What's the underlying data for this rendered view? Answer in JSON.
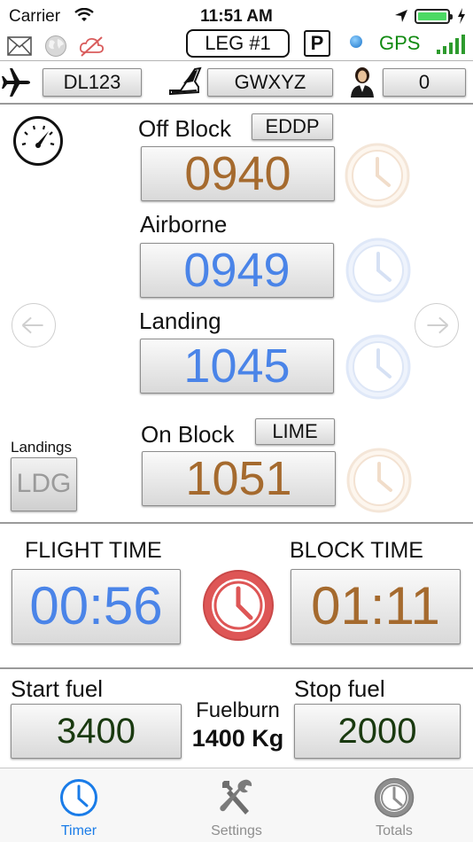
{
  "status_bar": {
    "carrier": "Carrier",
    "time": "11:51 AM"
  },
  "toolbar": {
    "leg_label": "LEG #1",
    "parking_label": "P",
    "gps_label": "GPS",
    "colors": {
      "gps_green": "#118a11",
      "gps_dot": "#1c74c9"
    }
  },
  "info": {
    "flight_number": "DL123",
    "registration": "GWXYZ",
    "crew_count": "0"
  },
  "timers": {
    "off_block": {
      "label": "Off Block",
      "airport": "EDDP",
      "time": "0940"
    },
    "airborne": {
      "label": "Airborne",
      "time": "0949"
    },
    "landing": {
      "label": "Landing",
      "time": "1045"
    },
    "on_block": {
      "label": "On Block",
      "airport": "LIME",
      "time": "1051"
    }
  },
  "landings": {
    "label": "Landings",
    "button": "LDG"
  },
  "totals": {
    "flight_time_label": "FLIGHT TIME",
    "flight_time": "00:56",
    "block_time_label": "BLOCK TIME",
    "block_time": "01:11"
  },
  "fuel": {
    "start_label": "Start fuel",
    "start_value": "3400",
    "burn_label": "Fuelburn",
    "burn_value": "1400 Kg",
    "stop_label": "Stop fuel",
    "stop_value": "2000"
  },
  "tabs": [
    {
      "label": "Timer",
      "active": true
    },
    {
      "label": "Settings",
      "active": false
    },
    {
      "label": "Totals",
      "active": false
    }
  ],
  "colors": {
    "brown": "#a56a2e",
    "blue": "#4a84e8",
    "green": "#19390f",
    "accent": "#1a7ce8",
    "red": "#de5656"
  }
}
